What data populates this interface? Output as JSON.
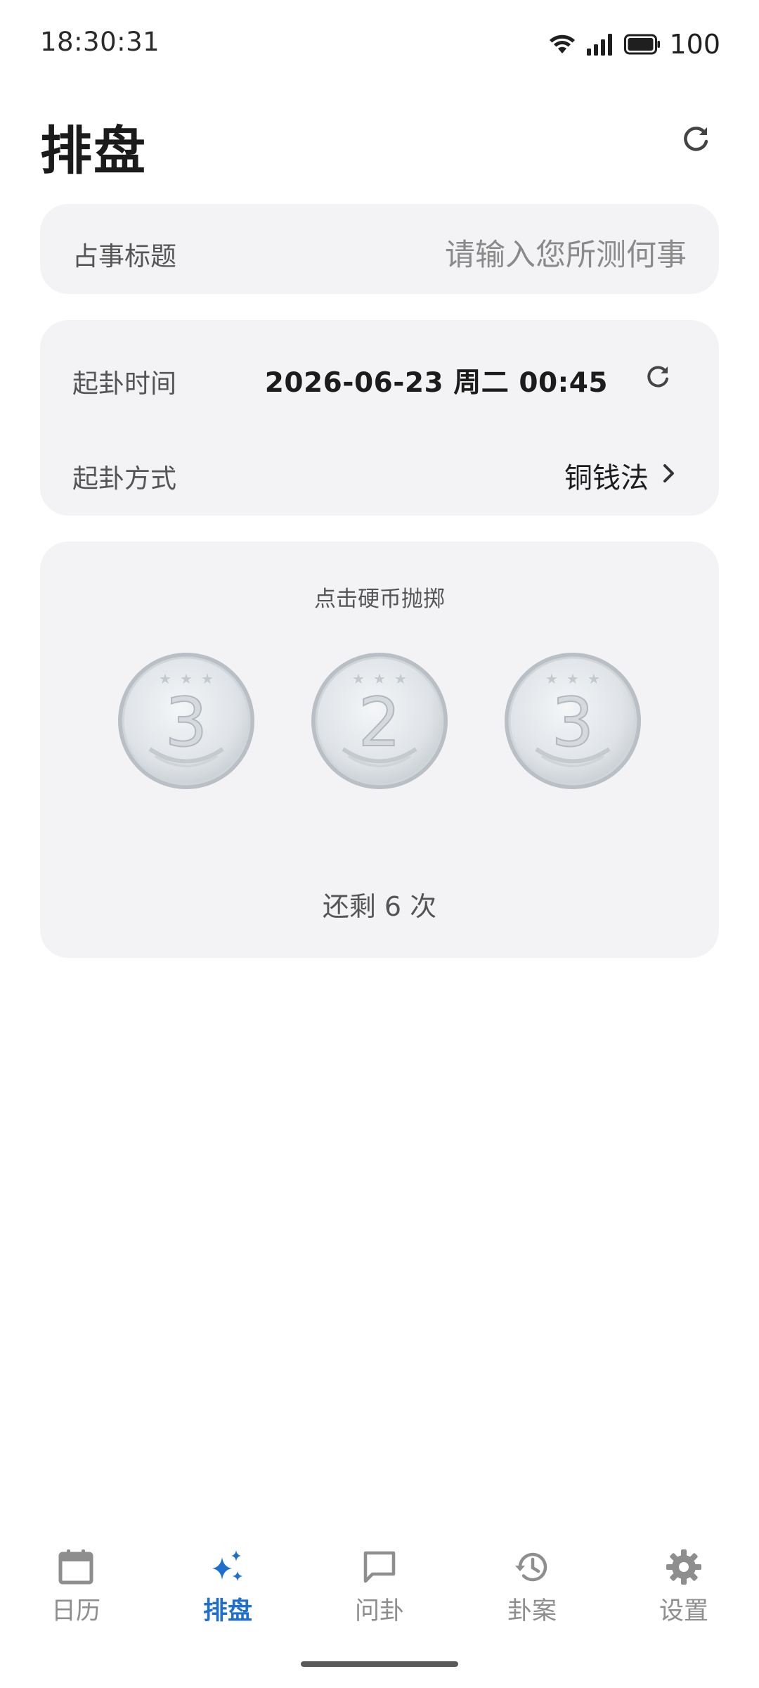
{
  "status_bar": {
    "time": "18:30:31",
    "battery": "100",
    "icons": [
      "wifi-icon",
      "signal-icon",
      "battery-icon"
    ]
  },
  "header": {
    "title": "排盘",
    "refresh_icon": "refresh-icon"
  },
  "question_card": {
    "label": "占事标题",
    "placeholder": "请输入您所测何事"
  },
  "time_card": {
    "time_label": "起卦时间",
    "time_value": "2026-06-23 周二  00:45",
    "method_label": "起卦方式",
    "method_value": "铜钱法"
  },
  "coins_card": {
    "hint": "点击硬币抛掷",
    "coins": [
      "3",
      "2",
      "3"
    ],
    "remaining": "还剩 6 次"
  },
  "bottom_nav": {
    "items": [
      {
        "label": "日历",
        "icon": "calendar-icon",
        "active": false
      },
      {
        "label": "排盘",
        "icon": "sparkle-icon",
        "active": true
      },
      {
        "label": "问卦",
        "icon": "chat-icon",
        "active": false
      },
      {
        "label": "卦案",
        "icon": "history-icon",
        "active": false
      },
      {
        "label": "设置",
        "icon": "gear-icon",
        "active": false
      }
    ]
  },
  "colors": {
    "accent": "#1f6fd1",
    "card_bg": "#f3f3f5",
    "inactive": "#8e8e8e"
  }
}
